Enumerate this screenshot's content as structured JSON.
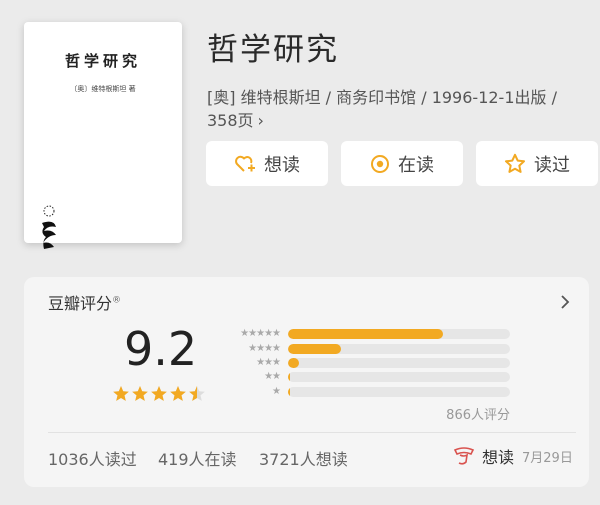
{
  "book": {
    "title": "哲学研究",
    "meta_line1": "[奥] 维特根斯坦 / 商务印书馆 / 1996-12-1出版 /",
    "meta_line2": "358页",
    "meta_chevron": "›"
  },
  "cover": {
    "title": "哲学研究",
    "author": "〔奥〕维特根斯坦 著"
  },
  "actions": [
    {
      "label": "想读",
      "icon": "heart-plus-icon"
    },
    {
      "label": "在读",
      "icon": "target-icon"
    },
    {
      "label": "读过",
      "icon": "star-outline-icon"
    }
  ],
  "rating": {
    "heading": "豆瓣评分",
    "registered": "®",
    "score": "9.2",
    "stars": 4.5,
    "breakdown": [
      {
        "stars": 5,
        "fraction": 0.7
      },
      {
        "stars": 4,
        "fraction": 0.24
      },
      {
        "stars": 3,
        "fraction": 0.05
      },
      {
        "stars": 2,
        "fraction": 0.01
      },
      {
        "stars": 1,
        "fraction": 0.005
      }
    ],
    "count_label": "866人评分"
  },
  "stats": {
    "read": "1036人读过",
    "reading": "419人在读",
    "want": "3721人想读"
  },
  "user_status": {
    "label": "想读",
    "date": "7月29日",
    "icon": "stamp-icon"
  },
  "colors": {
    "accent": "#f2a922",
    "rating_star": "#f2a922",
    "want_red": "#d9534f"
  }
}
